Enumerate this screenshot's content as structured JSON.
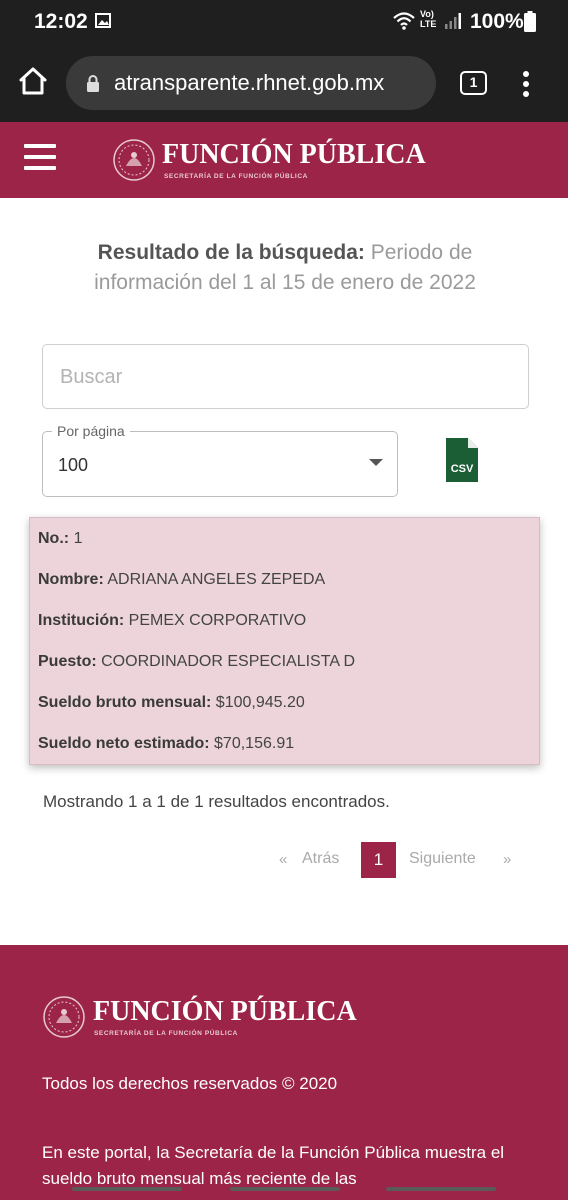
{
  "status_bar": {
    "time": "12:02",
    "network": "Vo) LTE",
    "battery": "100%"
  },
  "browser": {
    "url": "atransparente.rhnet.gob.mx",
    "tab_count": "1"
  },
  "header": {
    "brand_title": "FUNCIÓN PÚBLICA",
    "brand_subtitle": "SECRETARÍA DE LA FUNCIÓN PÚBLICA"
  },
  "result": {
    "heading_bold": "Resultado de la búsqueda:",
    "heading_rest": " Periodo de información del 1 al 15 de enero de 2022"
  },
  "search": {
    "placeholder": "Buscar"
  },
  "per_page": {
    "label": "Por página",
    "value": "100"
  },
  "csv_label": "CSV",
  "card": {
    "rows": [
      {
        "label": "No.:",
        "value": "1"
      },
      {
        "label": "Nombre:",
        "value": "ADRIANA ANGELES ZEPEDA"
      },
      {
        "label": "Institución:",
        "value": "PEMEX CORPORATIVO"
      },
      {
        "label": "Puesto:",
        "value": "COORDINADOR ESPECIALISTA D"
      },
      {
        "label": "Sueldo bruto mensual:",
        "value": "$100,945.20"
      },
      {
        "label": "Sueldo neto estimado:",
        "value": "$70,156.91"
      }
    ]
  },
  "results_count": "Mostrando 1 a 1 de 1 resultados encontrados.",
  "pagination": {
    "prev_arrow": "«",
    "prev": "Atrás",
    "current": "1",
    "next": "Siguiente",
    "next_arrow": "»"
  },
  "footer": {
    "rights": "Todos los derechos reservados © 2020",
    "text": "En este portal, la Secretaría de la Función Pública muestra el sueldo bruto mensual más reciente de las"
  },
  "colors": {
    "brand": "#9d2449",
    "card_bg": "#ecd4da",
    "chrome": "#1f1f1f"
  }
}
